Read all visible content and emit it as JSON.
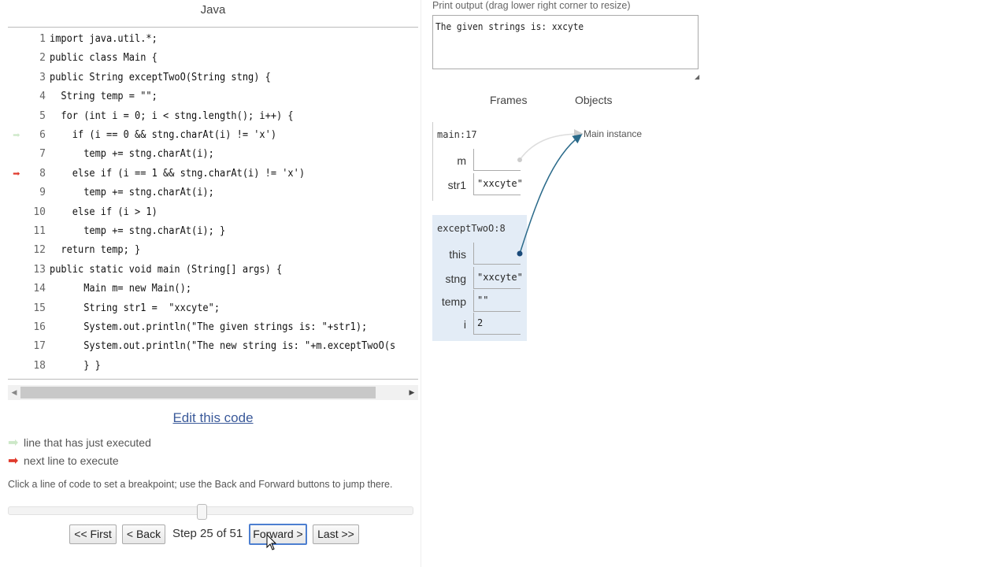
{
  "language": "Java",
  "code_lines": [
    {
      "num": "1",
      "text": "import java.util.*;"
    },
    {
      "num": "2",
      "text": "public class Main {"
    },
    {
      "num": "3",
      "text": "public String exceptTwoO(String stng) {"
    },
    {
      "num": "4",
      "text": "  String temp = \"\";"
    },
    {
      "num": "5",
      "text": "  for (int i = 0; i < stng.length(); i++) {"
    },
    {
      "num": "6",
      "text": "    if (i == 0 && stng.charAt(i) != 'x')"
    },
    {
      "num": "7",
      "text": "      temp += stng.charAt(i);"
    },
    {
      "num": "8",
      "text": "    else if (i == 1 && stng.charAt(i) != 'x')"
    },
    {
      "num": "9",
      "text": "      temp += stng.charAt(i);"
    },
    {
      "num": "10",
      "text": "    else if (i > 1)"
    },
    {
      "num": "11",
      "text": "      temp += stng.charAt(i); }"
    },
    {
      "num": "12",
      "text": "  return temp; }"
    },
    {
      "num": "13",
      "text": "public static void main (String[] args) {"
    },
    {
      "num": "14",
      "text": "      Main m= new Main();"
    },
    {
      "num": "15",
      "text": "      String str1 =  \"xxcyte\";"
    },
    {
      "num": "16",
      "text": "      System.out.println(\"The given strings is: \"+str1);"
    },
    {
      "num": "17",
      "text": "      System.out.println(\"The new string is: \"+m.exceptTwoO(s"
    },
    {
      "num": "18",
      "text": "      } }"
    }
  ],
  "arrows": {
    "just_executed_line": 6,
    "next_line": 8
  },
  "edit_link": "Edit this code",
  "legend": {
    "just_executed": "line that has just executed",
    "next_to_execute": "next line to execute"
  },
  "hint": "Click a line of code to set a breakpoint; use the Back and Forward buttons to jump there.",
  "slider": {
    "current_step": 25,
    "total_steps": 51
  },
  "nav": {
    "first": "<< First",
    "back": "< Back",
    "step_text": "Step 25 of 51",
    "forward": "Forward >",
    "last": "Last >>"
  },
  "print_output": {
    "label": "Print output (drag lower right corner to resize)",
    "text": "The given strings is: xxcyte"
  },
  "viz": {
    "frames_header": "Frames",
    "objects_header": "Objects",
    "frames": [
      {
        "name": "main:17",
        "vars": [
          {
            "name": "m",
            "value": ""
          },
          {
            "name": "str1",
            "value": "\"xxcyte\""
          }
        ]
      },
      {
        "name": "exceptTwoO:8",
        "vars": [
          {
            "name": "this",
            "value": ""
          },
          {
            "name": "stng",
            "value": "\"xxcyte\""
          },
          {
            "name": "temp",
            "value": "\"\""
          },
          {
            "name": "i",
            "value": "2"
          }
        ]
      }
    ],
    "object_label": "Main instance"
  },
  "colors": {
    "just_executed_arrow": "#cde8c8",
    "next_line_arrow": "#e03a2c",
    "active_frame_bg": "#e3ecf6",
    "pointer_arrow": "#2a6a8a"
  }
}
